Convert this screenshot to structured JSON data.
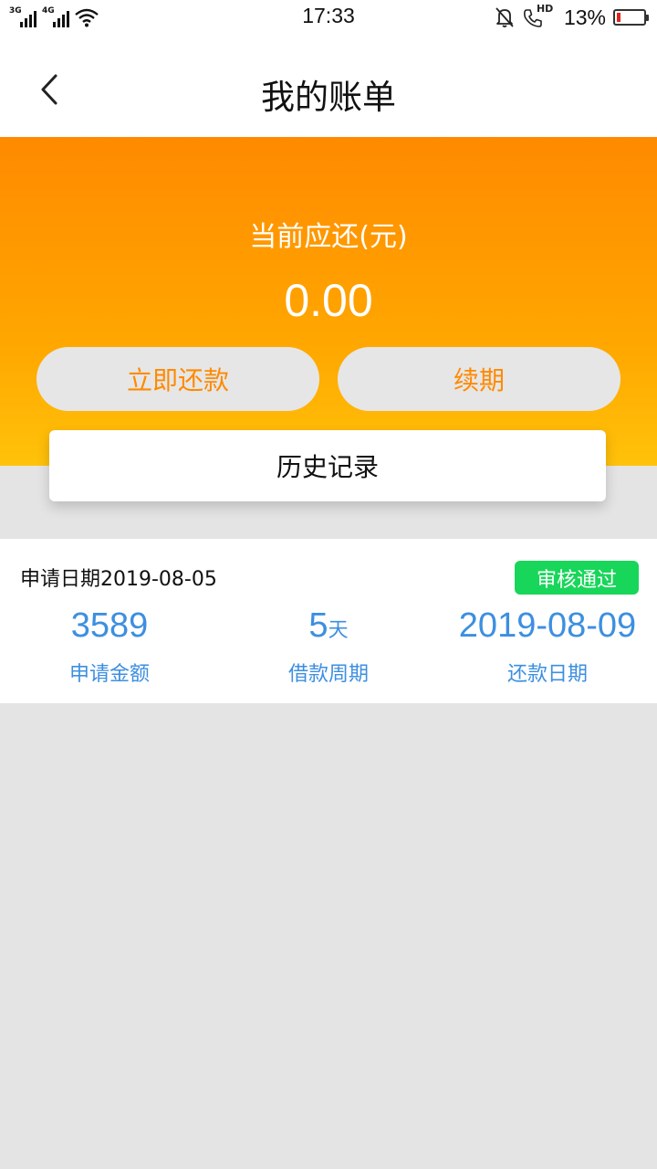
{
  "status_bar": {
    "sim1_network": "3G",
    "sim2_network": "4G",
    "time": "17:33",
    "call_label": "HD",
    "battery_percent": "13%",
    "battery_level": 0.13,
    "battery_color": "#e0231f"
  },
  "header": {
    "title": "我的账单"
  },
  "summary": {
    "due_label": "当前应还(元)",
    "due_amount": "0.00",
    "pay_now_label": "立即还款",
    "renew_label": "续期",
    "history_label": "历史记录"
  },
  "record": {
    "apply_date": "申请日期2019-08-05",
    "status": "审核通过",
    "amount_value": "3589",
    "amount_label": "申请金额",
    "period_value": "5",
    "period_unit": "天",
    "period_label": "借款周期",
    "repay_date_value": "2019-08-09",
    "repay_date_label": "还款日期"
  },
  "colors": {
    "accent_orange": "#ff8a00",
    "value_blue": "#3d8fe0",
    "status_green": "#18d65a"
  },
  "icons": {
    "back": "chevron-left-icon",
    "wifi": "wifi-icon",
    "mute": "bell-off-icon",
    "call": "phone-hd-icon",
    "battery": "battery-icon"
  }
}
